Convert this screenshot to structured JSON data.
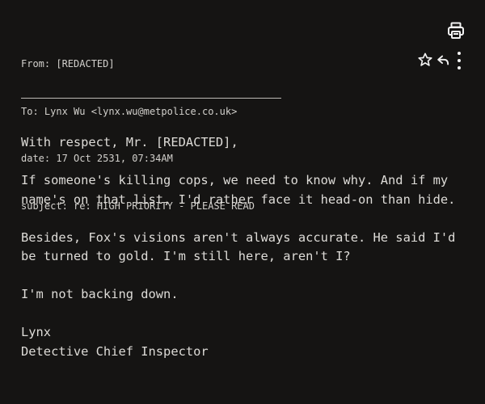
{
  "email": {
    "header": {
      "from": "From: [REDACTED]",
      "to": "To: Lynx Wu <lynx.wu@metpolice.co.uk>",
      "date": "date: 17 Oct 2531, 07:34AM",
      "subject": "subject: re: HIGH PRIORITY - PLEASE READ"
    },
    "body": {
      "greeting": "With respect, Mr. [REDACTED],",
      "paragraph_1": "If someone's killing cops, we need to know why. And if my name's on that list, I'd rather face it head-on than hide.",
      "paragraph_2": "Besides, Fox's visions aren't always accurate. He said I'd be turned to gold. I'm still here, aren't I?",
      "paragraph_3": "I'm not backing down.",
      "signature_name": "Lynx",
      "signature_title": "Detective Chief Inspector"
    }
  },
  "toolbar": {
    "print_icon": "printer-icon",
    "star_icon": "star-outline-icon",
    "reply_icon": "reply-arrow-icon",
    "more_icon": "vertical-ellipsis-icon"
  },
  "colors": {
    "background": "#151413",
    "text": "#dedcd8",
    "icon": "#f2f2f2"
  }
}
